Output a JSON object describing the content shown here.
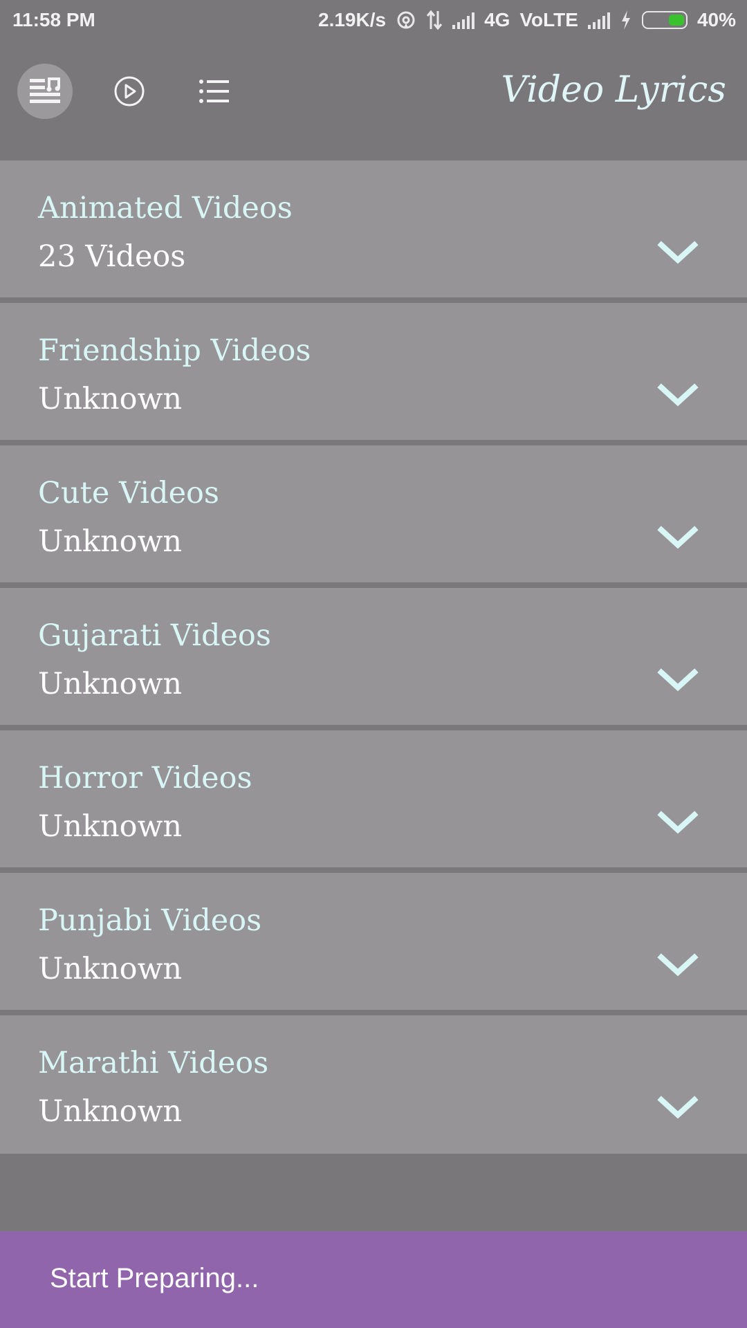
{
  "status_bar": {
    "time": "11:58 PM",
    "speed": "2.19K/s",
    "network": "4G",
    "volte": "VoLTE",
    "battery": "40%",
    "battery_level": 0.4
  },
  "header": {
    "title": "Video Lyrics",
    "tabs": [
      {
        "icon": "music-list-icon",
        "active": true
      },
      {
        "icon": "play-circle-icon",
        "active": false
      },
      {
        "icon": "list-icon",
        "active": false
      }
    ]
  },
  "categories": [
    {
      "title": "Animated Videos",
      "subtitle": "23 Videos"
    },
    {
      "title": "Friendship Videos",
      "subtitle": "Unknown"
    },
    {
      "title": "Cute Videos",
      "subtitle": "Unknown"
    },
    {
      "title": "Gujarati Videos",
      "subtitle": "Unknown"
    },
    {
      "title": "Horror Videos",
      "subtitle": "Unknown"
    },
    {
      "title": "Punjabi Videos",
      "subtitle": "Unknown"
    },
    {
      "title": "Marathi Videos",
      "subtitle": "Unknown"
    }
  ],
  "banner": {
    "text": "Start Preparing..."
  },
  "colors": {
    "background": "#79777a",
    "card": "#969497",
    "title_text": "#d9f6f7",
    "banner": "#9165ab",
    "battery": "#39c12e"
  }
}
